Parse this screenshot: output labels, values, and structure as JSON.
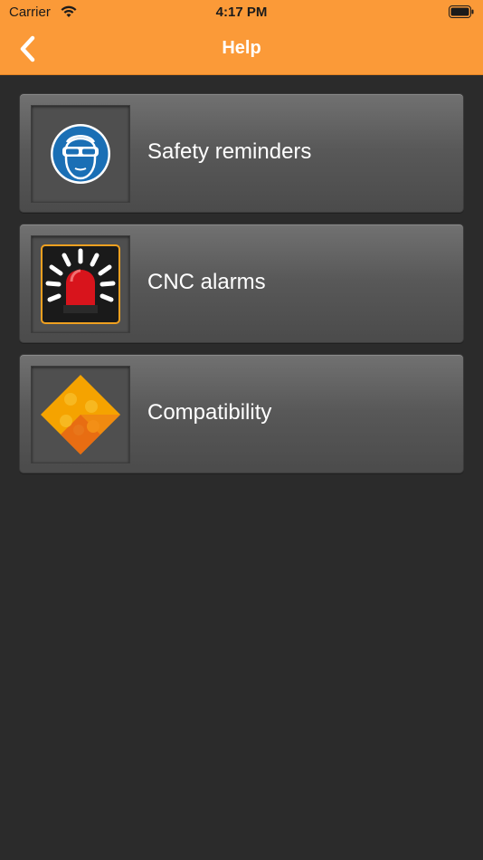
{
  "status_bar": {
    "carrier": "Carrier",
    "time": "4:17 PM"
  },
  "nav": {
    "title": "Help",
    "back_icon": "chevron-left-icon"
  },
  "menu": {
    "items": [
      {
        "label": "Safety reminders",
        "icon": "safety-goggles-icon"
      },
      {
        "label": "CNC alarms",
        "icon": "alarm-beacon-icon"
      },
      {
        "label": "Compatibility",
        "icon": "puzzle-icon"
      }
    ]
  },
  "colors": {
    "header": "#fb9a38",
    "background": "#2b2b2b",
    "item": "#5a5a5a",
    "text": "#ffffff"
  }
}
